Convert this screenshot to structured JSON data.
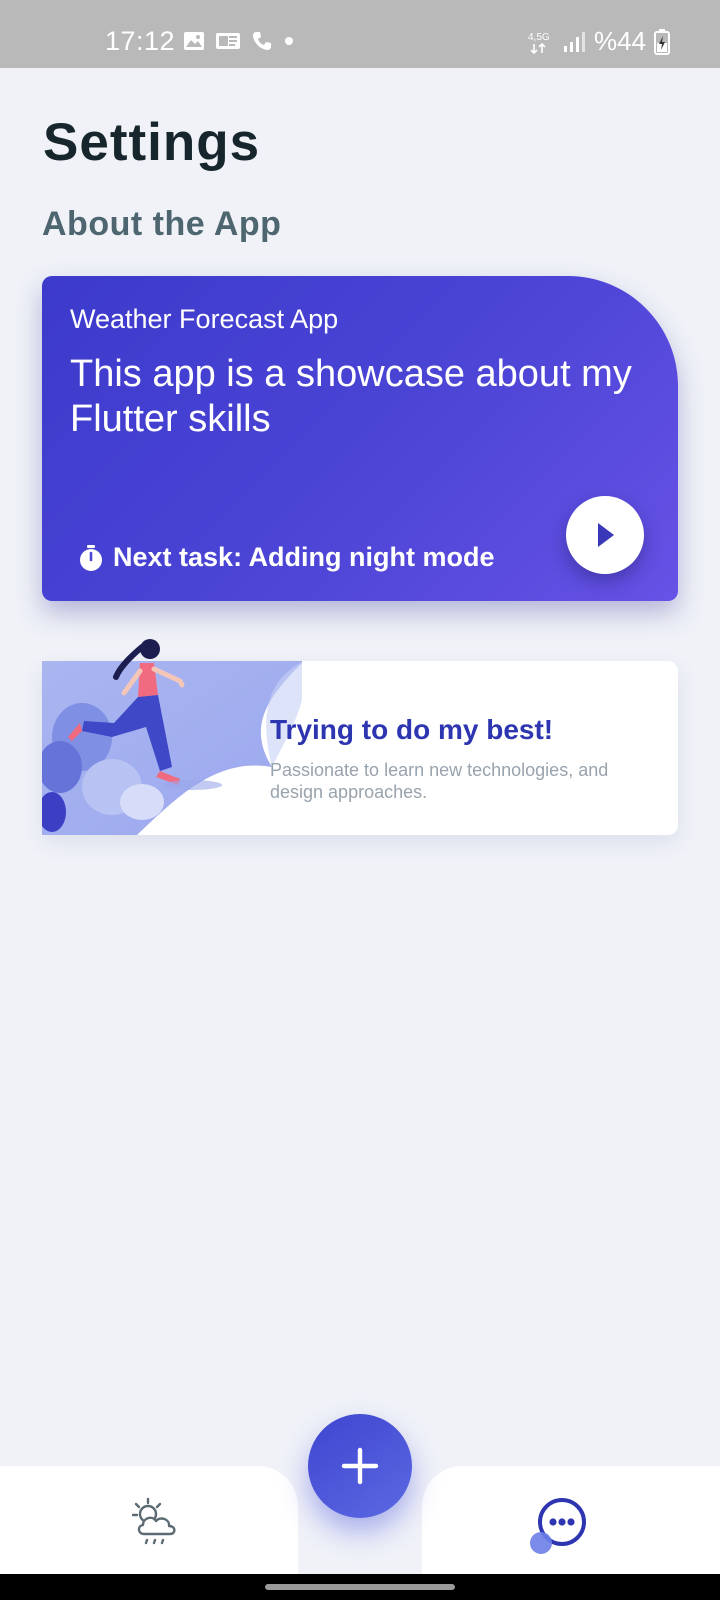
{
  "status_bar": {
    "time": "17:12",
    "network": "4,5G",
    "battery": "%44",
    "icons": [
      "image-icon",
      "notification-icon",
      "phone-icon",
      "dot-icon",
      "signal-icon",
      "battery-icon"
    ]
  },
  "page": {
    "title": "Settings",
    "section_title": "About the App"
  },
  "promo_card": {
    "eyebrow": "Weather Forecast App",
    "headline": "This app is a showcase about my Flutter skills",
    "task_label": "Next task: Adding night mode",
    "icons": [
      "stopwatch-icon",
      "play-icon"
    ]
  },
  "motivation_card": {
    "title": "Trying to do my best!",
    "description": "Passionate to learn new technologies, and design approaches."
  },
  "bottom_nav": {
    "items": [
      "weather-icon",
      "more-icon"
    ],
    "fab_icon": "plus-icon"
  },
  "colors": {
    "background": "#f0f2f8",
    "card_gradient_start": "#3c3acb",
    "card_gradient_end": "#6752e6",
    "accent_blue": "#2e35b0",
    "title_dark": "#17262d",
    "section_grey": "#4e6670"
  }
}
